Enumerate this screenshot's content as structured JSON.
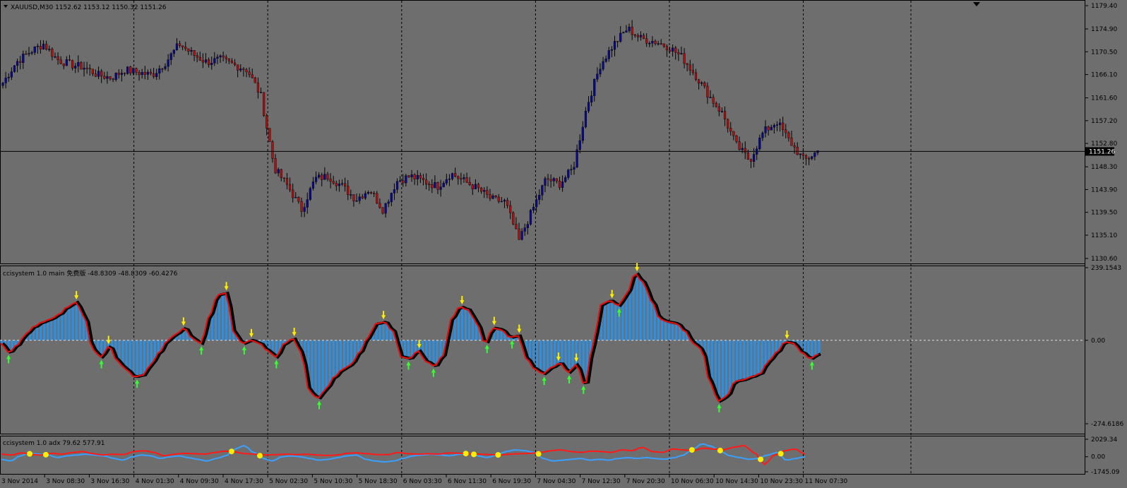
{
  "window": {
    "symbol_header": "XAUUSD,M30  1152.62  1153.12  1150.32  1151.26",
    "current_price_label": "1151.26"
  },
  "panes": {
    "main": {
      "price_ticks": [
        "1179.40",
        "1174.90",
        "1170.50",
        "1166.10",
        "1161.60",
        "1157.20",
        "1152.80",
        "1148.30",
        "1143.90",
        "1139.50",
        "1135.10",
        "1130.60"
      ],
      "price_range": [
        1130.6,
        1179.4
      ],
      "current_price": 1151.26
    },
    "cci": {
      "title": "ccisystem 1.0 main 免费版 -48.8309 -48.8309 -60.4276",
      "ticks": [
        "239.1543",
        "0.00",
        "-274.6186"
      ],
      "range": [
        -274.6186,
        239.1543
      ]
    },
    "adx": {
      "title": "ccisystem 1.0 adx  79.62 577.91",
      "ticks": [
        "2029.34",
        "0.00",
        "-1745.09"
      ],
      "range": [
        -1745.09,
        2029.34
      ]
    }
  },
  "time_labels": [
    "3 Nov 2014",
    "3 Nov 08:30",
    "3 Nov 16:30",
    "4 Nov 01:30",
    "4 Nov 09:30",
    "4 Nov 17:30",
    "5 Nov 02:30",
    "5 Nov 10:30",
    "5 Nov 18:30",
    "6 Nov 03:30",
    "6 Nov 11:30",
    "6 Nov 19:30",
    "7 Nov 04:30",
    "7 Nov 12:30",
    "7 Nov 20:30",
    "10 Nov 06:30",
    "10 Nov 14:30",
    "10 Nov 23:30",
    "11 Nov 07:30"
  ],
  "colors": {
    "background": "#6e6e6e",
    "bull_candle": "#0a0a8c",
    "bear_candle": "#b01010",
    "wick": "#000000",
    "cci_fill": "#2e8fe0",
    "cci_line_fast": "#000000",
    "cci_line_slow": "#e01010",
    "adx_plus": "#ff1a1a",
    "adx_minus": "#3aa0ff",
    "marker_yellow": "#ffee00",
    "arrow_up": "#33ff33",
    "arrow_down": "#ffee00"
  },
  "chart_data": [
    {
      "type": "candlestick",
      "title": "XAUUSD,M30",
      "ylim": [
        1130.6,
        1179.4
      ],
      "x": [
        "3 Nov 2014",
        "3 Nov 08:30",
        "3 Nov 16:30",
        "4 Nov 01:30",
        "4 Nov 09:30",
        "4 Nov 17:30",
        "5 Nov 02:30",
        "5 Nov 10:30",
        "5 Nov 18:30",
        "6 Nov 03:30",
        "6 Nov 11:30",
        "6 Nov 19:30",
        "7 Nov 04:30",
        "7 Nov 12:30",
        "7 Nov 20:30",
        "10 Nov 06:30",
        "10 Nov 14:30",
        "10 Nov 23:30"
      ],
      "close_path": [
        1164.5,
        1168.5,
        1170.5,
        1172.0,
        1169.0,
        1168.0,
        1167.5,
        1166.0,
        1165.5,
        1167.0,
        1166.5,
        1166.0,
        1168.5,
        1172.0,
        1170.0,
        1168.5,
        1169.0,
        1168.0,
        1167.0,
        1162.0,
        1148.0,
        1144.5,
        1140.0,
        1146.0,
        1146.5,
        1144.5,
        1142.0,
        1144.0,
        1140.0,
        1145.5,
        1146.5,
        1145.5,
        1144.5,
        1147.0,
        1145.5,
        1144.0,
        1142.0,
        1141.5,
        1134.0,
        1140.0,
        1146.0,
        1145.0,
        1148.0,
        1160.0,
        1168.0,
        1172.0,
        1175.0,
        1173.0,
        1172.5,
        1171.5,
        1169.5,
        1166.0,
        1162.0,
        1158.5,
        1152.5,
        1149.5,
        1155.0,
        1157.0,
        1153.0,
        1149.5,
        1151.3
      ]
    },
    {
      "type": "area",
      "title": "ccisystem 1.0 main",
      "ylim": [
        -274.6186,
        239.1543
      ],
      "values": [
        -10,
        -40,
        -15,
        20,
        45,
        60,
        70,
        85,
        110,
        125,
        80,
        -30,
        -55,
        -20,
        -70,
        -95,
        -120,
        -115,
        -80,
        -40,
        0,
        20,
        40,
        5,
        -10,
        80,
        150,
        155,
        20,
        -10,
        0,
        -10,
        -35,
        -55,
        -10,
        5,
        -40,
        -170,
        -190,
        -160,
        -120,
        -95,
        -80,
        -40,
        10,
        55,
        60,
        30,
        -55,
        -60,
        -35,
        -70,
        -85,
        -50,
        70,
        110,
        100,
        60,
        -10,
        40,
        35,
        10,
        15,
        -60,
        -95,
        -110,
        -90,
        -75,
        -105,
        -80,
        -150,
        -10,
        120,
        130,
        115,
        150,
        220,
        190,
        130,
        70,
        60,
        55,
        30,
        -10,
        -30,
        -140,
        -200,
        -185,
        -135,
        -130,
        -120,
        -110,
        -70,
        -40,
        -5,
        -10,
        -40,
        -60,
        -45
      ],
      "series": [
        {
          "name": "",
          "values": []
        }
      ]
    },
    {
      "type": "line",
      "title": "ccisystem 1.0 adx",
      "ylim": [
        -1745.09,
        2029.34
      ],
      "series": [
        {
          "name": "",
          "values": [
            300,
            200,
            450,
            250,
            200,
            400,
            300,
            500,
            600,
            350,
            200,
            300,
            250,
            600,
            700,
            500,
            100,
            300,
            400,
            350,
            300,
            500,
            650,
            550,
            350,
            300,
            200,
            250,
            300,
            250,
            300,
            200,
            150,
            200,
            400,
            450,
            350,
            250,
            250,
            500,
            350,
            300,
            350,
            300,
            450,
            400,
            350,
            300,
            250,
            200,
            300,
            350,
            400,
            500,
            700,
            800,
            600,
            500,
            650,
            600,
            500,
            800,
            700,
            1100,
            600,
            500,
            900,
            800,
            700,
            1000,
            900,
            800,
            1100,
            1300,
            500,
            -900,
            200,
            700,
            900,
            300
          ]
        },
        {
          "name": "",
          "values": [
            -300,
            -500,
            100,
            400,
            300,
            200,
            -100,
            100,
            200,
            300,
            200,
            100,
            -200,
            -400,
            0,
            200,
            100,
            -200,
            0,
            100,
            -100,
            -300,
            -500,
            -200,
            100,
            900,
            1300,
            500,
            -200,
            -500,
            0,
            100,
            0,
            -200,
            -400,
            -300,
            -100,
            100,
            200,
            -300,
            -500,
            -600,
            -500,
            -200,
            100,
            200,
            300,
            200,
            100,
            300,
            400,
            100,
            -100,
            200,
            600,
            800,
            700,
            500,
            -200,
            -500,
            -400,
            -300,
            -200,
            -400,
            -300,
            -400,
            -200,
            -100,
            -200,
            -100,
            -200,
            -300,
            -100,
            200,
            900,
            1500,
            1200,
            600,
            100,
            -100,
            -300,
            -200,
            200,
            500,
            -400,
            -200,
            0
          ]
        }
      ]
    }
  ]
}
